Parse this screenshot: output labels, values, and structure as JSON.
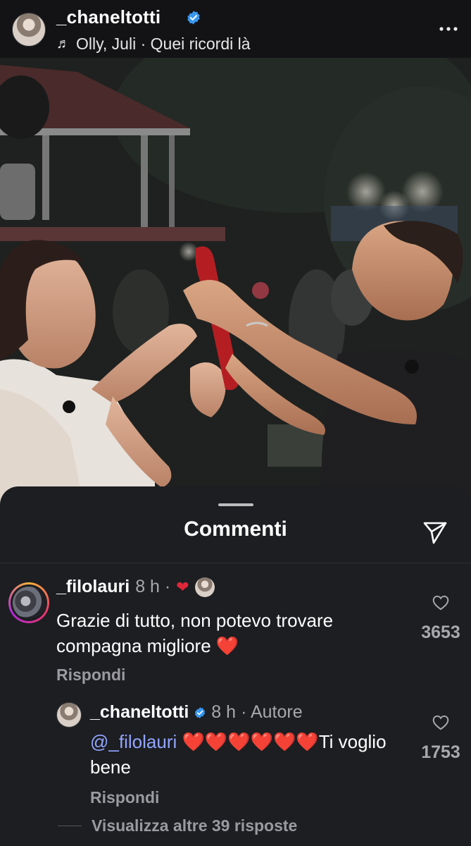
{
  "header": {
    "username": "_chaneltotti",
    "music": "Olly, Juli · Quei ricordi là",
    "more_icon": "ellipsis-icon"
  },
  "sheet": {
    "title": "Commenti",
    "send_icon": "paper-plane-icon"
  },
  "comment": {
    "username": "_filolauri",
    "time": "8 h ·",
    "text": "Grazie di tutto, non potevo trovare compagna migliore ❤️",
    "reply_label": "Rispondi",
    "likes": "3653"
  },
  "reply": {
    "username": "_chaneltotti",
    "time": "8 h",
    "author_label": "· Autore",
    "mention": "@_filolauri",
    "text": " ❤️❤️❤️❤️❤️❤️Ti voglio bene",
    "reply_label": "Rispondi",
    "likes": "1753"
  },
  "more_replies": "Visualizza altre 39 risposte",
  "colors": {
    "accent_mention": "#92a4ff",
    "heart": "#e0263a",
    "verified": "#3897f0"
  }
}
